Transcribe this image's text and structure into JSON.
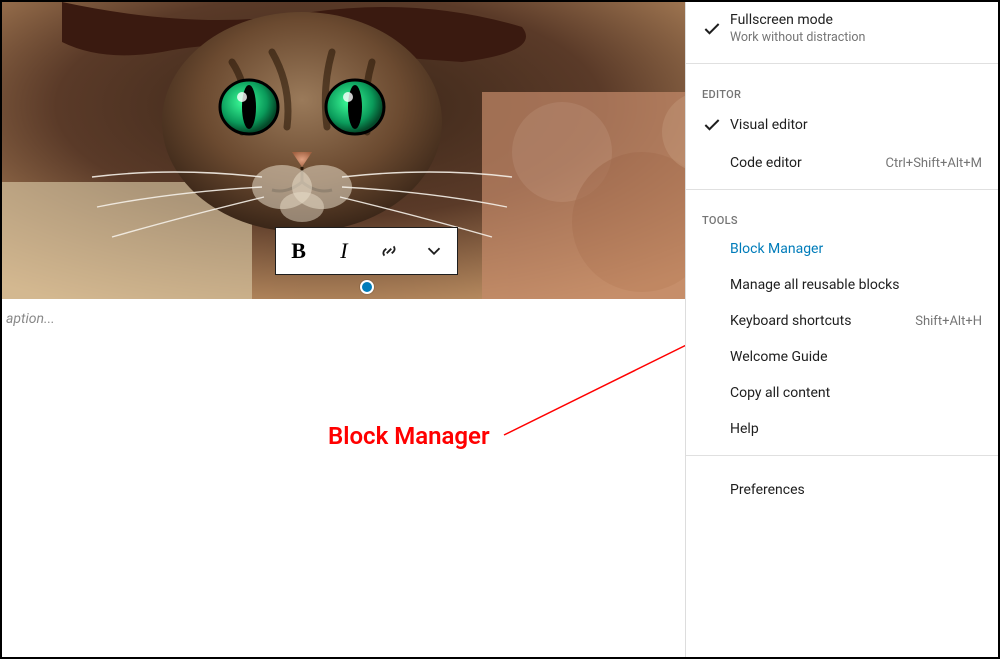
{
  "image": {
    "caption_placeholder": "aption..."
  },
  "toolbar": {
    "bold": "B",
    "italic": "I"
  },
  "annotation": {
    "label": "Block Manager"
  },
  "menu": {
    "view": {
      "fullscreen": {
        "title": "Fullscreen mode",
        "desc": "Work without distraction",
        "checked": true
      }
    },
    "editor": {
      "label": "EDITOR",
      "visual": {
        "title": "Visual editor",
        "checked": true
      },
      "code": {
        "title": "Code editor",
        "shortcut": "Ctrl+Shift+Alt+M",
        "checked": false
      }
    },
    "tools": {
      "label": "TOOLS",
      "block_manager": {
        "title": "Block Manager"
      },
      "reusable": {
        "title": "Manage all reusable blocks"
      },
      "shortcuts": {
        "title": "Keyboard shortcuts",
        "shortcut": "Shift+Alt+H"
      },
      "welcome": {
        "title": "Welcome Guide"
      },
      "copy_all": {
        "title": "Copy all content"
      },
      "help": {
        "title": "Help"
      }
    },
    "options": {
      "preferences": {
        "title": "Preferences"
      }
    }
  }
}
